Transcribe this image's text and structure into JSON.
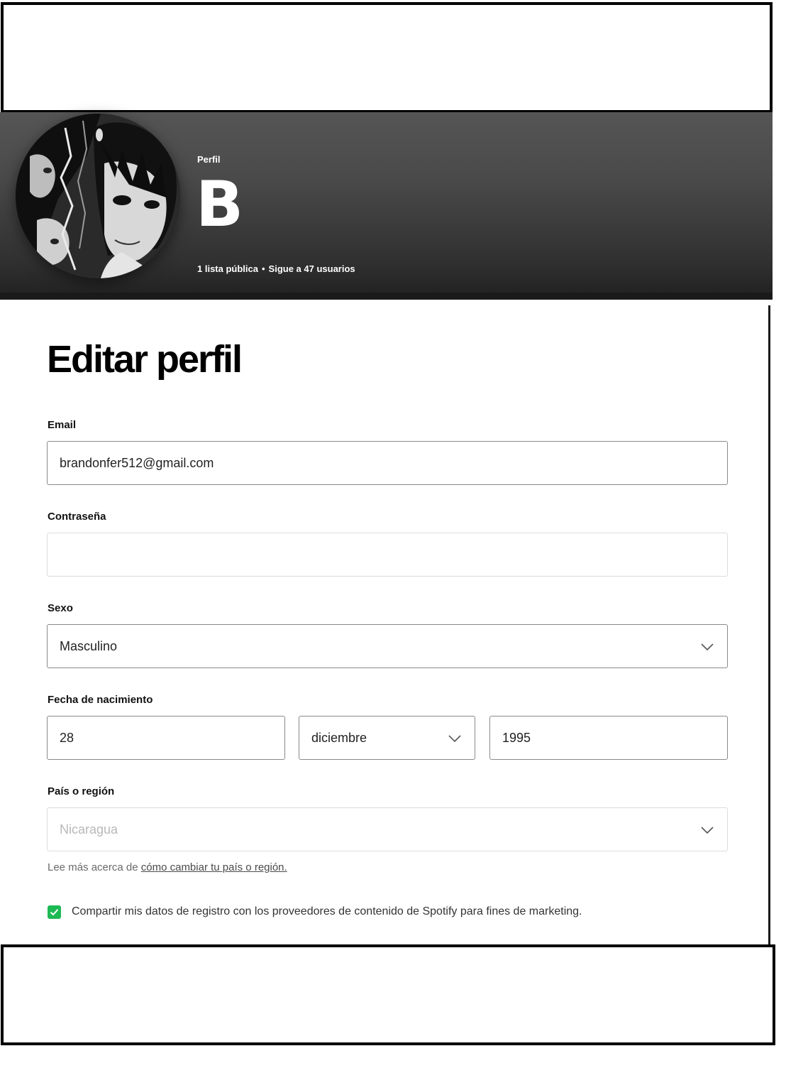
{
  "profile_header": {
    "type_label": "Perfil",
    "name": "B",
    "stats": {
      "playlists": "1 lista pública",
      "separator": "•",
      "following": "Sigue a 47 usuarios"
    },
    "avatar_icon": "user-avatar-image"
  },
  "edit_profile": {
    "title": "Editar perfil",
    "email": {
      "label": "Email",
      "value": "brandonfer512@gmail.com"
    },
    "password": {
      "label": "Contraseña",
      "value": ""
    },
    "gender": {
      "label": "Sexo",
      "value": "Masculino",
      "icon": "chevron-down-icon"
    },
    "birthdate": {
      "label": "Fecha de nacimiento",
      "day": "28",
      "month": "diciembre",
      "year": "1995",
      "month_icon": "chevron-down-icon"
    },
    "country": {
      "label": "País o región",
      "value": "Nicaragua",
      "icon": "chevron-down-icon"
    },
    "help": {
      "prefix": "Lee más acerca de",
      "link": "cómo cambiar tu país o región."
    },
    "marketing": {
      "checked": true,
      "label": "Compartir mis datos de registro con los proveedores de contenido de Spotify para fines de marketing.",
      "icon": "checkmark-icon"
    }
  },
  "colors": {
    "checkbox_accent": "#1db954",
    "header_background": "#454545"
  }
}
